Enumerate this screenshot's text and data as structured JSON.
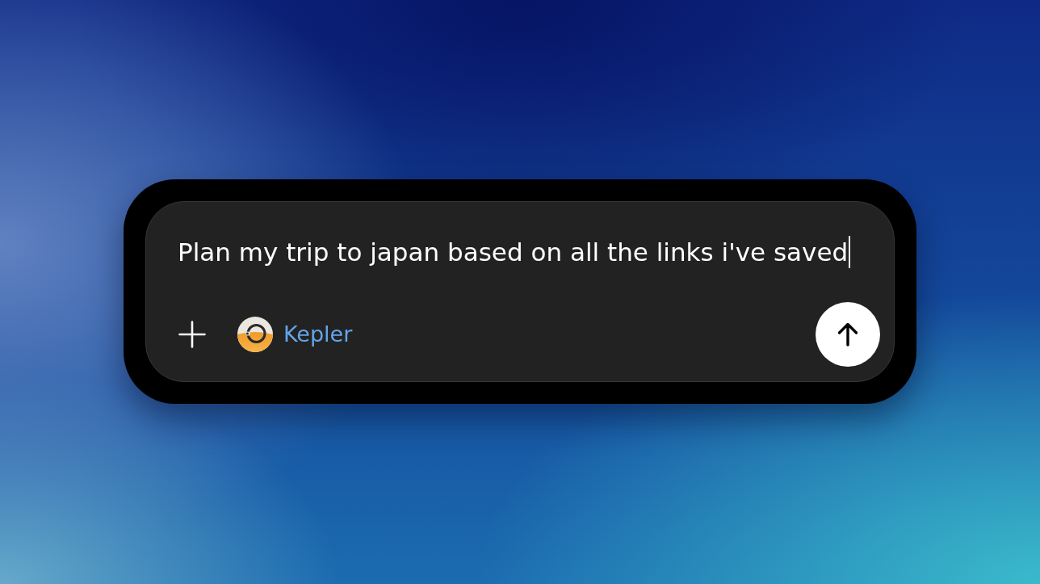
{
  "composer": {
    "input": {
      "value": "Plan my trip to japan based on all the links i've saved",
      "focused": true
    },
    "agent": {
      "label": "Kepler"
    }
  }
}
